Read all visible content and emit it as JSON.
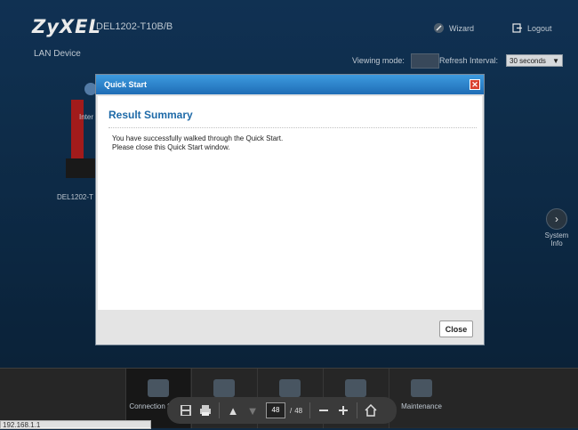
{
  "header": {
    "brand": "ZyXEL",
    "model": "DEL1202-T10B/B",
    "section": "LAN Device",
    "wizard_label": "Wizard",
    "logout_label": "Logout",
    "wizard_icon": "wizard-icon",
    "logout_icon": "logout-icon"
  },
  "toolbar": {
    "viewing_mode_label": "Viewing mode:",
    "refresh_label": "Refresh Interval:",
    "refresh_value": "30 seconds"
  },
  "diagram": {
    "device_label": "DEL1202-T",
    "inter_label": "Inter"
  },
  "side": {
    "system_info_label": "System Info"
  },
  "bottom_nav": {
    "tabs": [
      {
        "label": "Connection Status",
        "icon": "connection-icon"
      },
      {
        "label": "",
        "icon": "gear-icon"
      },
      {
        "label": "",
        "icon": "shield-icon"
      },
      {
        "label": "",
        "icon": "monitor-icon"
      },
      {
        "label": "Maintenance",
        "icon": "maintenance-icon"
      }
    ]
  },
  "status_bar": {
    "url": "192.168.1.1"
  },
  "dialog": {
    "title": "Quick Start",
    "heading": "Result Summary",
    "message_line1": "You have successfully walked through the Quick Start.",
    "message_line2": "Please close this Quick Start window.",
    "close_button": "Close",
    "close_x": "✕"
  },
  "pdf_toolbar": {
    "current_page": "48",
    "separator": "/",
    "total_pages": "48"
  },
  "colors": {
    "title_bar": "#1f6db5",
    "heading": "#1e6aa8",
    "background": "#12365a"
  }
}
